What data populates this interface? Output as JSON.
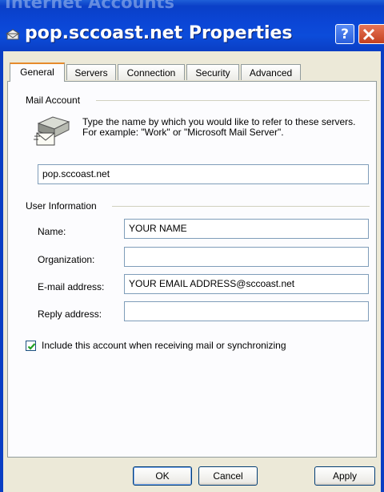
{
  "window": {
    "title": "pop.sccoast.net Properties",
    "background_title": "Internet Accounts",
    "help_label": "?"
  },
  "tabs": [
    {
      "label": "General",
      "active": true
    },
    {
      "label": "Servers",
      "active": false
    },
    {
      "label": "Connection",
      "active": false
    },
    {
      "label": "Security",
      "active": false
    },
    {
      "label": "Advanced",
      "active": false
    }
  ],
  "mail_account": {
    "group_label": "Mail Account",
    "description": "Type the name by which you would like to refer to these servers.  For example: \"Work\" or \"Microsoft Mail Server\".",
    "account_name": "pop.sccoast.net"
  },
  "user_info": {
    "group_label": "User Information",
    "name_label": "Name:",
    "name_value": "YOUR NAME",
    "organization_label": "Organization:",
    "organization_value": "",
    "email_label": "E-mail address:",
    "email_value": "YOUR EMAIL ADDRESS@sccoast.net",
    "reply_label": "Reply address:",
    "reply_value": ""
  },
  "include_account": {
    "label": "Include this account when receiving mail or synchronizing",
    "checked": true
  },
  "buttons": {
    "ok": "OK",
    "cancel": "Cancel",
    "apply": "Apply"
  },
  "colors": {
    "titlebar": "#0a3ec4",
    "dialog_bg": "#ECE9D8",
    "tab_highlight": "#e68b2c",
    "checkmark": "#21a121"
  }
}
